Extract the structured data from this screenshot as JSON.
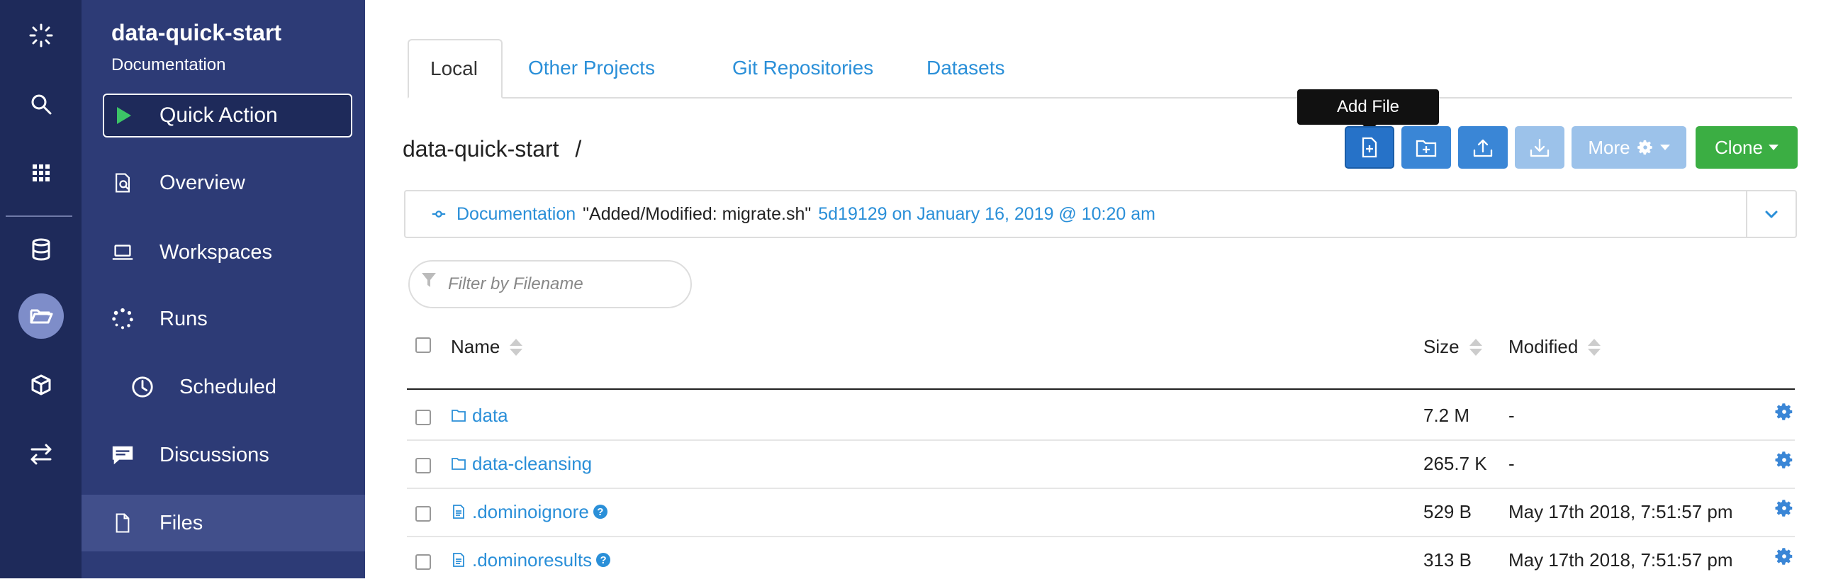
{
  "sidebar": {
    "project_name": "data-quick-start",
    "project_subtitle": "Documentation",
    "quick_action": "Quick Action",
    "items": [
      {
        "label": "Overview",
        "icon": "overview-icon"
      },
      {
        "label": "Workspaces",
        "icon": "laptop-icon"
      },
      {
        "label": "Runs",
        "icon": "spinner-icon"
      },
      {
        "label": "Scheduled",
        "icon": "clock-icon"
      },
      {
        "label": "Discussions",
        "icon": "chat-icon"
      },
      {
        "label": "Files",
        "icon": "file-icon"
      }
    ],
    "active": "Files"
  },
  "rail": {
    "icons": [
      "logo-icon",
      "search-icon",
      "apps-grid-icon",
      "database-icon",
      "folder-open-icon",
      "cube-icon",
      "swap-arrows-icon"
    ],
    "active": "folder-open-icon"
  },
  "tabs": [
    {
      "label": "Local",
      "active": true
    },
    {
      "label": "Other Projects",
      "active": false
    },
    {
      "label": "Git Repositories",
      "active": false
    },
    {
      "label": "Datasets",
      "active": false
    }
  ],
  "breadcrumb": {
    "path": "data-quick-start",
    "separator": "/"
  },
  "toolbar": {
    "tooltip": "Add File",
    "more_label": "More",
    "clone_label": "Clone"
  },
  "commit": {
    "branch": "Documentation",
    "message": "\"Added/Modified: migrate.sh\"",
    "hash_date": "5d19129 on January 16, 2019 @ 10:20 am"
  },
  "filter": {
    "placeholder": "Filter by Filename"
  },
  "table": {
    "columns": {
      "name": "Name",
      "size": "Size",
      "modified": "Modified"
    },
    "rows": [
      {
        "name": "data",
        "type": "folder",
        "size": "7.2 M",
        "modified": "-"
      },
      {
        "name": "data-cleansing",
        "type": "folder",
        "size": "265.7 K",
        "modified": "-"
      },
      {
        "name": ".dominoignore",
        "type": "file",
        "help": true,
        "size": "529 B",
        "modified": "May 17th 2018, 7:51:57 pm"
      },
      {
        "name": ".dominoresults",
        "type": "file",
        "help": true,
        "size": "313 B",
        "modified": "May 17th 2018, 7:51:57 pm"
      }
    ]
  },
  "colors": {
    "rail": "#1e2a5a",
    "sidebar": "#2d3b76",
    "link": "#2a8fd8",
    "primary_button": "#2672c8",
    "clone_button": "#3bae43",
    "play_icon": "#3cc467"
  }
}
